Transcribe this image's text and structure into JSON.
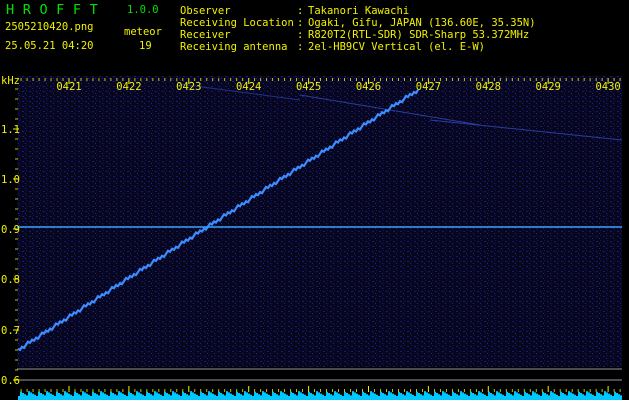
{
  "app": {
    "title": "HROFFT",
    "version": "1.0.0"
  },
  "file": {
    "name": "2505210420.png",
    "datetime": "25.05.21 04:20",
    "meteor_label": "meteor",
    "meteor_count": "19"
  },
  "info": [
    {
      "key": "Observer",
      "sep": ":",
      "value": "Takanori Kawachi"
    },
    {
      "key": "Receiving Location",
      "sep": ":",
      "value": "Ogaki, Gifu, JAPAN (136.60E, 35.35N)"
    },
    {
      "key": "Receiver",
      "sep": ":",
      "value": "R820T2(RTL-SDR) SDR-Sharp 53.372MHz"
    },
    {
      "key": "Receiving antenna",
      "sep": ":",
      "value": "2el-HB9CV Vertical (el. E-W)"
    }
  ],
  "spectrogram": {
    "y_unit": "kHz",
    "y_ticks": [
      "1.1",
      "1.0",
      "0.9",
      "0.8",
      "0.7",
      "0.6"
    ],
    "x_ticks": [
      "0421",
      "0422",
      "0423",
      "0424",
      "0425",
      "0426",
      "0427",
      "0428",
      "0429",
      "0430"
    ],
    "colors": {
      "background": "#06061e",
      "noise": "#1c1c78",
      "signal": "#3c8cff",
      "carrier": "#28a0ff",
      "tick": "#f2f200",
      "power_bar": "#00c8ff"
    }
  }
}
